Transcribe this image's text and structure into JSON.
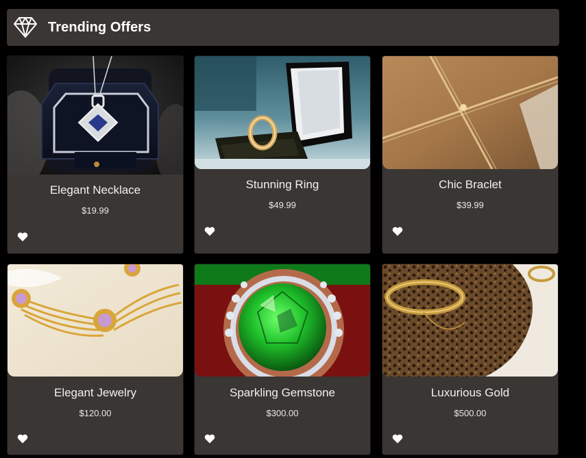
{
  "header": {
    "title": "Trending Offers",
    "icon": "diamond-icon"
  },
  "products": [
    {
      "name": "Elegant Necklace",
      "price": "$19.99",
      "image": "necklace-pendant-in-box",
      "favorite_icon": "heart-icon"
    },
    {
      "name": "Stunning Ring",
      "price": "$49.99",
      "image": "gold-ring-in-box",
      "favorite_icon": "heart-icon"
    },
    {
      "name": "Chic Braclet",
      "price": "$39.99",
      "image": "gold-wrapped-gift-box",
      "favorite_icon": "heart-icon"
    },
    {
      "name": "Elegant Jewelry",
      "price": "$120.00",
      "image": "gold-amethyst-necklace",
      "favorite_icon": "heart-icon"
    },
    {
      "name": "Sparkling Gemstone",
      "price": "$300.00",
      "image": "green-gemstone-ring",
      "favorite_icon": "heart-icon"
    },
    {
      "name": "Luxurious Gold",
      "price": "$500.00",
      "image": "gold-bangle-on-leopard-fabric",
      "favorite_icon": "heart-icon"
    }
  ],
  "colors": {
    "background": "#000000",
    "panel": "#3a3634",
    "text": "#ffffff"
  }
}
